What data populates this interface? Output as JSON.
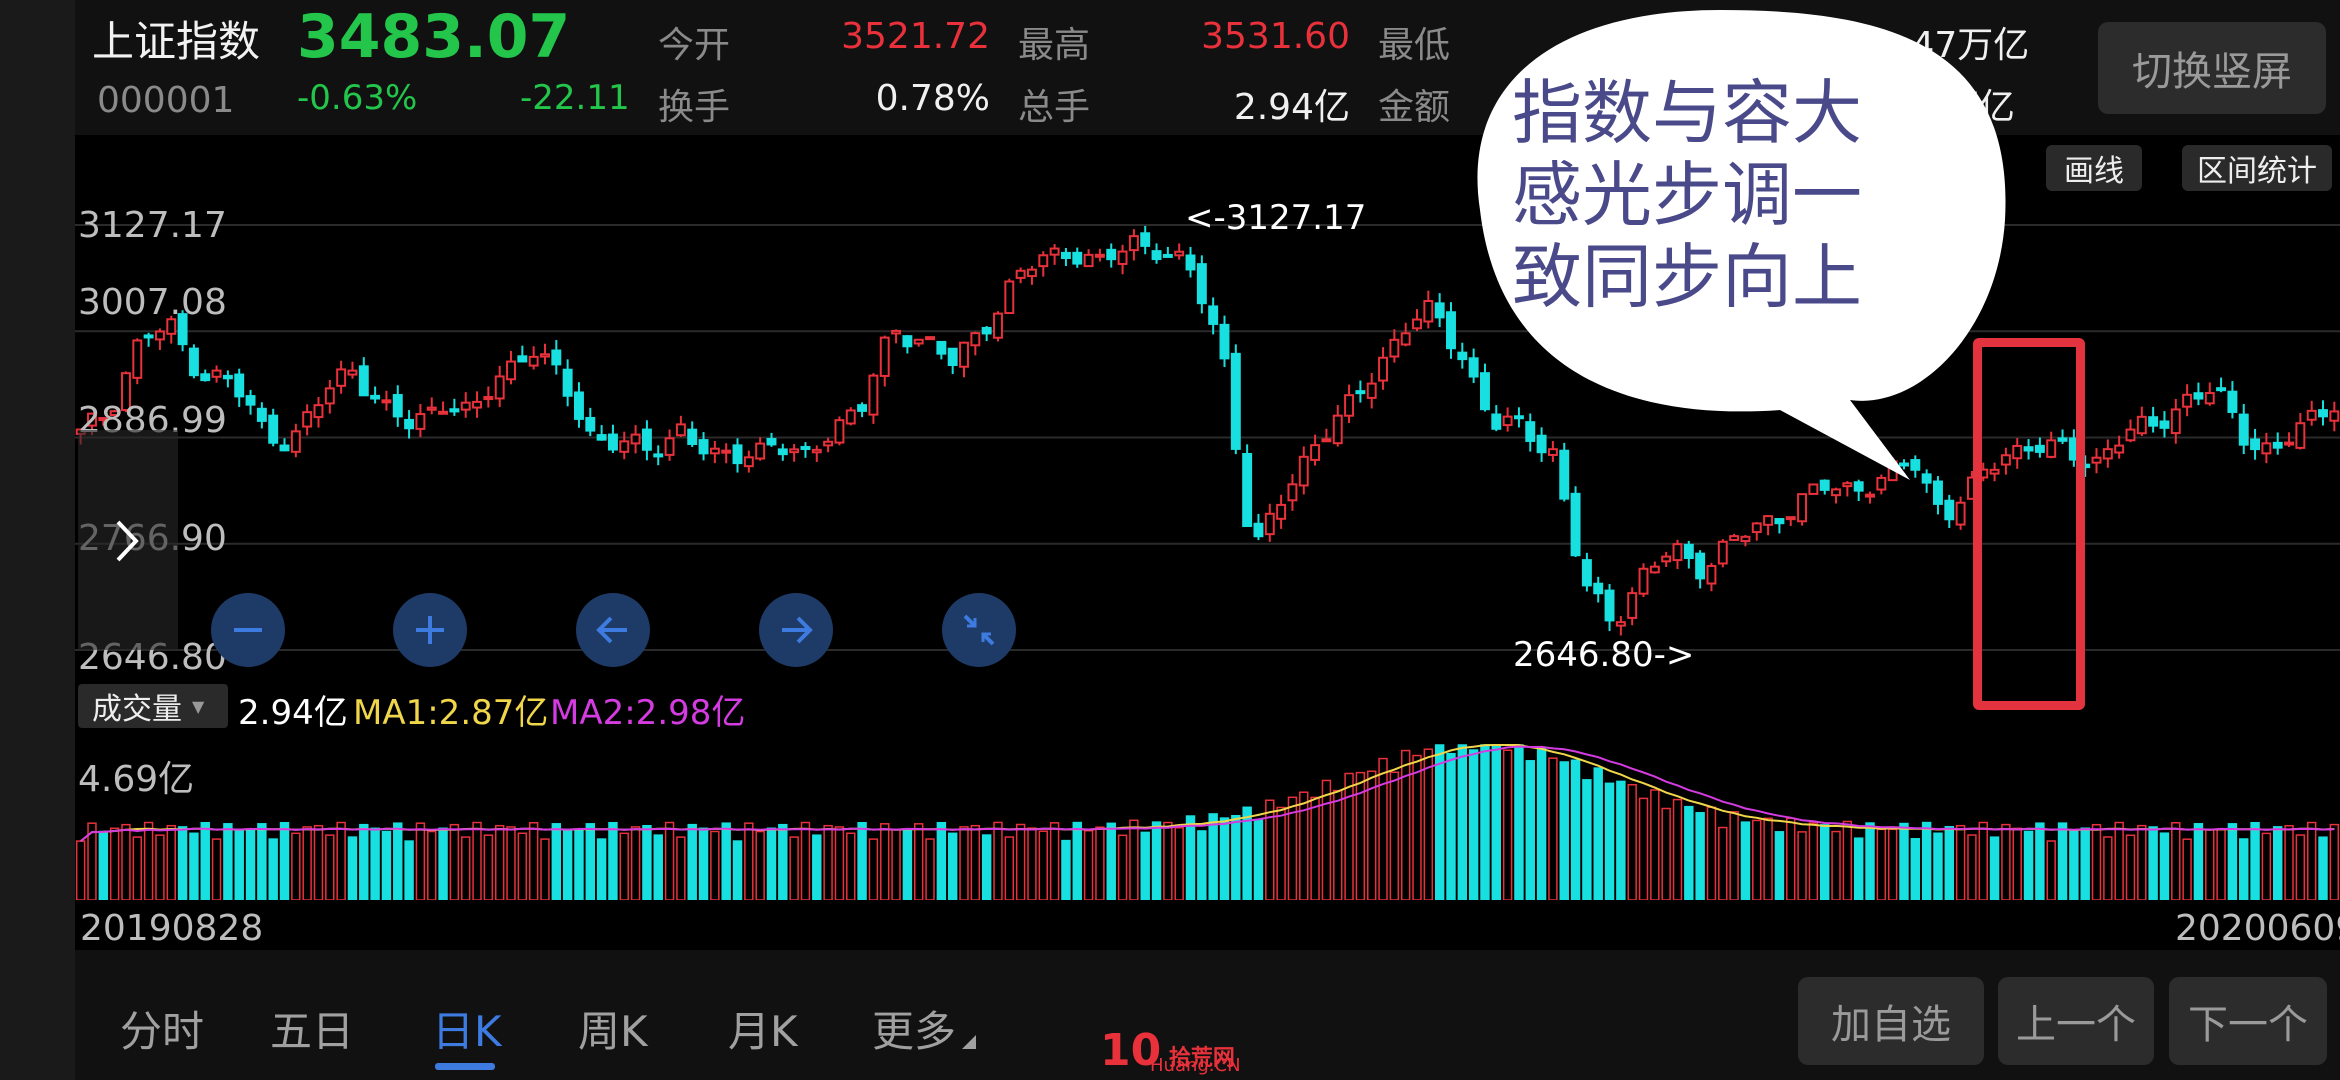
{
  "header": {
    "index_name": "上证指数",
    "index_code": "000001",
    "price": "3483.07",
    "change_pct": "-0.63%",
    "change_abs": "-22.11",
    "open_label": "今开",
    "open_value": "3521.72",
    "high_label": "最高",
    "high_value": "3531.60",
    "low_label": "最低",
    "turnover_label": "换手",
    "turnover_value": "0.78%",
    "volume_label": "总手",
    "volume_value": "2.94亿",
    "amount_label": "金额",
    "right_top_value": ".47万亿",
    "right_bottom_value": "7万亿",
    "switch_button": "切换竖屏"
  },
  "toolbar": {
    "draw_button": "画线",
    "range_button": "区间统计"
  },
  "annotation": {
    "bubble_text_line1": "指数与容大",
    "bubble_text_line2": "感光步调一",
    "bubble_text_line3": "致同步向上",
    "highlight_color": "#e2333f"
  },
  "price_chart": {
    "y_labels": [
      "3127.17",
      "3007.08",
      "2886.99",
      "2766.90",
      "2646.80"
    ],
    "max_marker": "<-3127.17",
    "min_marker": "2646.80->"
  },
  "volume": {
    "selector_label": "成交量",
    "current_value": "2.94亿",
    "ma1": "MA1:2.87亿",
    "ma2": "MA2:2.98亿",
    "max_label": "4.69亿",
    "start_date": "20190828",
    "end_date": "20200609"
  },
  "tabs": {
    "items": [
      "分时",
      "五日",
      "日K",
      "周K",
      "月K",
      "更多"
    ],
    "active": "日K"
  },
  "actions": {
    "add_watch": "加自选",
    "prev": "上一个",
    "next": "下一个"
  },
  "watermark": {
    "text": "拾荒网",
    "sub": "Huang.CN"
  },
  "colors": {
    "up": "#e8313a",
    "down": "#19e0e0",
    "ma1": "#f0d64a",
    "ma2": "#d43be0",
    "accent": "#3d7be0"
  },
  "chart_data": {
    "type": "candlestick",
    "x_range": [
      "20190828",
      "20200609"
    ],
    "ylim": [
      2646.8,
      3127.17
    ],
    "max_value": 3127.17,
    "min_value": 2646.8,
    "close_trend": [
      2890,
      2920,
      3000,
      3010,
      2960,
      2950,
      2900,
      2880,
      2930,
      2970,
      2920,
      2900,
      2930,
      2910,
      2960,
      2990,
      2950,
      2890,
      2880,
      2870,
      2900,
      2860,
      2870,
      2880,
      2860,
      2900,
      2920,
      3010,
      3000,
      2970,
      3010,
      3060,
      3090,
      3100,
      3080,
      3110,
      3100,
      3070,
      2990,
      2750,
      2820,
      2880,
      2910,
      2960,
      3010,
      3030,
      2980,
      2900,
      2900,
      2870,
      2720,
      2680,
      2730,
      2760,
      2740,
      2770,
      2790,
      2810,
      2830,
      2830,
      2840,
      2860,
      2800,
      2830,
      2870,
      2880,
      2870,
      2860,
      2890,
      2900,
      2930,
      2940,
      2890,
      2870,
      2900,
      2930
    ],
    "volume_ma_labels": [
      "MA1:2.87亿",
      "MA2:2.98亿"
    ]
  }
}
